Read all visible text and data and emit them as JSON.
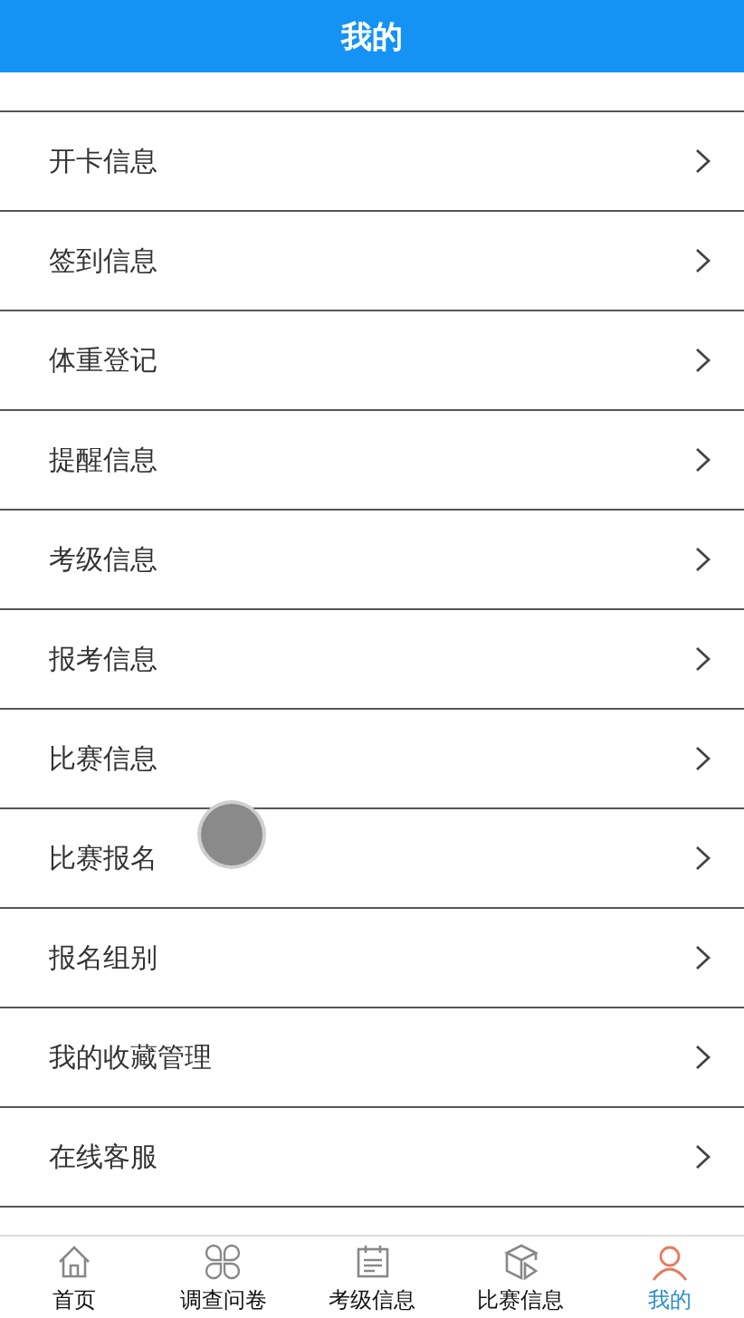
{
  "header": {
    "title": "我的"
  },
  "menu": [
    {
      "label": "开卡信息"
    },
    {
      "label": "签到信息"
    },
    {
      "label": "体重登记"
    },
    {
      "label": "提醒信息"
    },
    {
      "label": "考级信息"
    },
    {
      "label": "报考信息"
    },
    {
      "label": "比赛信息"
    },
    {
      "label": "比赛报名"
    },
    {
      "label": "报名组别"
    },
    {
      "label": "我的收藏管理"
    },
    {
      "label": "在线客服"
    }
  ],
  "tab_bar": [
    {
      "label": "首页",
      "kind": "home",
      "selected": false
    },
    {
      "label": "调查问卷",
      "kind": "clover",
      "selected": false
    },
    {
      "label": "考级信息",
      "kind": "calendar",
      "selected": false
    },
    {
      "label": "比赛信息",
      "kind": "cube",
      "selected": false
    },
    {
      "label": "我的",
      "kind": "person",
      "selected": true
    }
  ]
}
